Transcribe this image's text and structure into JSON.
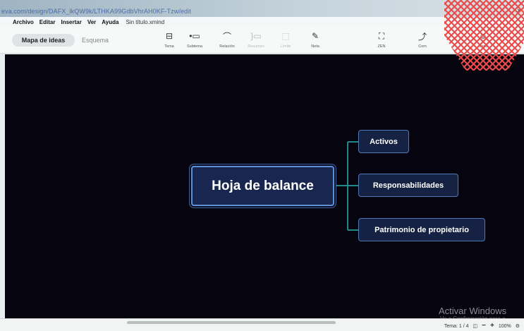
{
  "browser": {
    "url": "eva.com/design/DAFX_lkQW9k/LTHKA99GdbVhrAH0KF-Tzw/edit",
    "close_glyph": "×"
  },
  "menu": {
    "items": [
      "Archivo",
      "Editar",
      "Insertar",
      "Ver",
      "Ayuda"
    ],
    "document_title": "Sin título.xmind"
  },
  "view_switch": {
    "active": "Mapa de ideas",
    "inactive": "Esquema"
  },
  "toolbar": {
    "tools": [
      {
        "name": "Tema",
        "icon": "topic-icon",
        "glyph": "⊟",
        "disabled": false
      },
      {
        "name": "Subtema",
        "icon": "subtopic-icon",
        "glyph": "•▭",
        "disabled": false
      },
      {
        "name": "Relación",
        "icon": "relation-icon",
        "glyph": "⌒",
        "disabled": false
      },
      {
        "name": "Resumen",
        "icon": "summary-icon",
        "glyph": "}▭",
        "disabled": true
      },
      {
        "name": "Límite",
        "icon": "boundary-icon",
        "glyph": "⬚",
        "disabled": true
      },
      {
        "name": "Nota",
        "icon": "note-icon",
        "glyph": "✎",
        "disabled": false
      },
      {
        "name": "ZEN",
        "icon": "zen-icon",
        "glyph": "⛶",
        "disabled": false
      },
      {
        "name": "Com",
        "icon": "share-icon",
        "glyph": "⤴",
        "disabled": false
      },
      {
        "name": "Icono",
        "icon": "icon-icon",
        "glyph": "☺",
        "disabled": false
      }
    ]
  },
  "mindmap": {
    "central": "Hoja de balance",
    "branches": [
      "Activos",
      "Responsabilidades",
      "Patrimonio de propietario"
    ],
    "colors": {
      "canvas": "#06040f",
      "topic_fill": "#162244",
      "topic_border": "#4f78b8",
      "link": "#1f8a8a"
    }
  },
  "watermark": {
    "title": "Activar Windows",
    "subtitle": "Ve a Configuración para a"
  },
  "status": {
    "topic_count": "Tema: 1 / 4",
    "zoom_out": "−",
    "zoom_in": "+",
    "zoom": "100%",
    "mode_glyph": "◫",
    "settings_glyph": "⚙"
  },
  "decoration_color": "#e94b4b"
}
